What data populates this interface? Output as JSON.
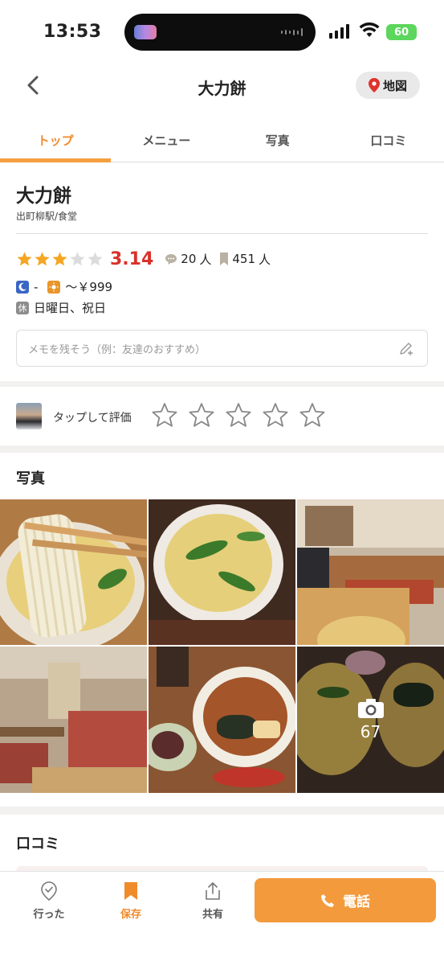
{
  "status_bar": {
    "time": "13:53",
    "battery": "60"
  },
  "header": {
    "title": "大力餅",
    "map_label": "地図"
  },
  "tabs": [
    {
      "label": "トップ",
      "active": true
    },
    {
      "label": "メニュー",
      "active": false
    },
    {
      "label": "写真",
      "active": false
    },
    {
      "label": "口コミ",
      "active": false
    }
  ],
  "shop": {
    "name": "大力餅",
    "area": "出町柳駅/食堂",
    "rating": "3.14",
    "rating_stars": 3,
    "reviews_count": "20",
    "saves_count": "451",
    "unit": "人",
    "dinner_price": "-",
    "lunch_price": "～￥999",
    "closed_badge": "休",
    "holidays": "日曜日、祝日"
  },
  "memo": {
    "placeholder": "メモを残そう（例：友達のおすすめ）"
  },
  "rate": {
    "label": "タップして評価",
    "max_stars": 5
  },
  "photos": {
    "title": "写真",
    "more_count": "67"
  },
  "reviews": {
    "title": "口コミ"
  },
  "bottom_bar": {
    "visited": "行った",
    "save": "保存",
    "share": "共有",
    "call": "電話"
  },
  "colors": {
    "accent": "#f08b2c",
    "rating": "#d8322b",
    "star": "#f5a623",
    "call": "#f39a3c"
  }
}
